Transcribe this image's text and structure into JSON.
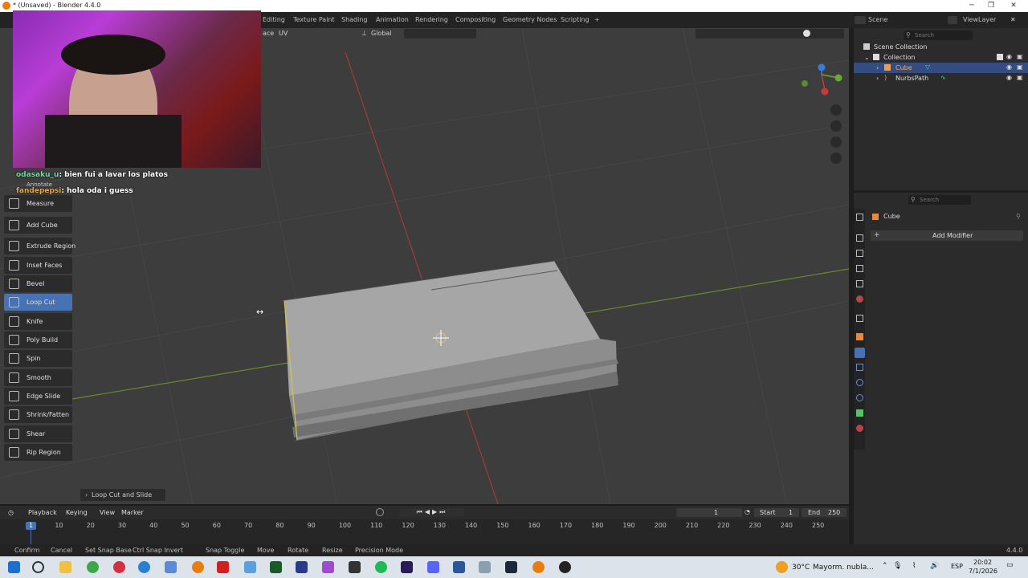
{
  "window": {
    "title": "* (Unsaved) - Blender 4.4.0",
    "minimize": "─",
    "maximize": "❐",
    "close": "✕"
  },
  "workspace_tabs": [
    "Editing",
    "Texture Paint",
    "Shading",
    "Animation",
    "Rendering",
    "Compositing",
    "Geometry Nodes",
    "Scripting",
    "+"
  ],
  "scene": {
    "scene_label": "Scene",
    "view_layer_label": "ViewLayer"
  },
  "viewport_header": {
    "face_menu": "ace",
    "uv_menu": "UV",
    "orientation": "Global"
  },
  "stream_chat": [
    {
      "user": "odasaku_u",
      "message": "bien fui a lavar los platos",
      "user_color": "#64e0a0"
    },
    {
      "user": "fandepepsi",
      "message": "hola oda i guess",
      "user_color": "#f5a623"
    }
  ],
  "toolbar": {
    "annotate_label": "Annotate",
    "tools": [
      {
        "id": "measure",
        "label": "Measure",
        "icon": "measure-icon"
      },
      {
        "id": "add-cube",
        "label": "Add Cube",
        "icon": "add-cube-icon"
      },
      {
        "id": "extrude-region",
        "label": "Extrude Region",
        "icon": "extrude-icon"
      },
      {
        "id": "inset-faces",
        "label": "Inset Faces",
        "icon": "inset-icon"
      },
      {
        "id": "bevel",
        "label": "Bevel",
        "icon": "bevel-icon"
      },
      {
        "id": "loop-cut",
        "label": "Loop Cut",
        "icon": "loop-cut-icon",
        "active": true
      },
      {
        "id": "knife",
        "label": "Knife",
        "icon": "knife-icon"
      },
      {
        "id": "poly-build",
        "label": "Poly Build",
        "icon": "poly-build-icon"
      },
      {
        "id": "spin",
        "label": "Spin",
        "icon": "spin-icon"
      },
      {
        "id": "smooth",
        "label": "Smooth",
        "icon": "smooth-icon"
      },
      {
        "id": "edge-slide",
        "label": "Edge Slide",
        "icon": "edge-slide-icon"
      },
      {
        "id": "shrink-fatten",
        "label": "Shrink/Fatten",
        "icon": "shrink-icon"
      },
      {
        "id": "shear",
        "label": "Shear",
        "icon": "shear-icon"
      },
      {
        "id": "rip-region",
        "label": "Rip Region",
        "icon": "rip-icon"
      }
    ]
  },
  "operator_panel": {
    "label": "Loop Cut and Slide"
  },
  "outliner": {
    "search_placeholder": "Search",
    "rows": [
      {
        "label": "Scene Collection",
        "selected": false
      },
      {
        "label": "Collection",
        "selected": false
      },
      {
        "label": "Cube",
        "selected": true
      },
      {
        "label": "NurbsPath",
        "selected": false
      }
    ]
  },
  "properties": {
    "search_placeholder": "Search",
    "object_name": "Cube",
    "add_modifier_label": "Add Modifier"
  },
  "timeline": {
    "menus": [
      "Playback",
      "Keying",
      "View",
      "Marker"
    ],
    "current_frame": "1",
    "start_label": "Start",
    "start_value": "1",
    "end_label": "End",
    "end_value": "250",
    "frame_ticks": [
      "1",
      "10",
      "20",
      "30",
      "40",
      "50",
      "60",
      "70",
      "80",
      "90",
      "100",
      "110",
      "120",
      "130",
      "140",
      "150",
      "160",
      "170",
      "180",
      "190",
      "200",
      "210",
      "220",
      "230",
      "240",
      "250"
    ]
  },
  "statusbar": {
    "items": [
      "Confirm",
      "Cancel",
      "Set Snap Base",
      "Ctrl Snap Invert",
      "Snap Toggle",
      "Move",
      "Rotate",
      "Resize",
      "Precision Mode"
    ],
    "version": "4.4.0"
  },
  "taskbar": {
    "weather_temp": "30°C",
    "weather_text": "Mayorm. nubla...",
    "lang": "ESP",
    "time": "20:02",
    "date": "7/1/2026",
    "colors": {
      "accent": "#4772b3",
      "selection": "#334d80"
    }
  }
}
